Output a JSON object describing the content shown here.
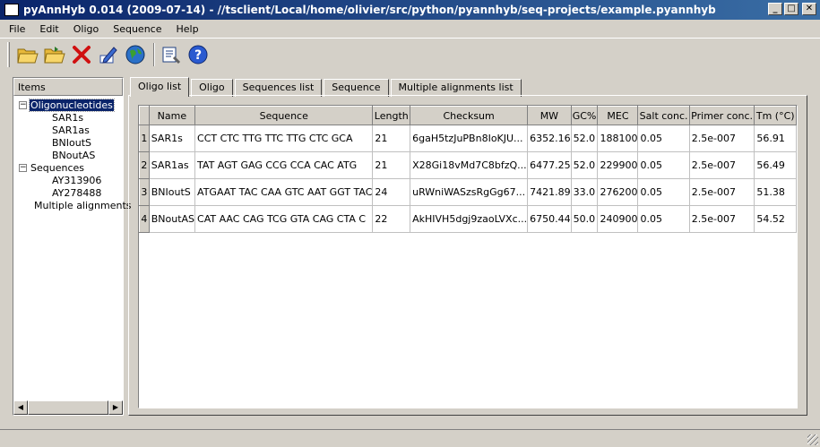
{
  "window": {
    "title": "pyAnnHyb 0.014 (2009-07-14) - //tsclient/Local/home/olivier/src/python/pyannhyb/seq-projects/example.pyannhyb",
    "minimize": "_",
    "maximize": "□",
    "close": "✕"
  },
  "menu": [
    "File",
    "Edit",
    "Oligo",
    "Sequence",
    "Help"
  ],
  "toolbar": {
    "open_icon": "open-folder-icon",
    "open2_icon": "open-folder-alt-icon",
    "delete_icon": "red-x-icon",
    "edit_icon": "pencil-icon",
    "globe_icon": "globe-icon",
    "tool_icon": "tool-icon",
    "help_icon": "help-icon"
  },
  "sidebar": {
    "header": "Items",
    "tree": {
      "oligos": {
        "label": "Oligonucleotides",
        "children": [
          "SAR1s",
          "SAR1as",
          "BNIoutS",
          "BNoutAS"
        ]
      },
      "sequences": {
        "label": "Sequences",
        "children": [
          "AY313906",
          "AY278488"
        ]
      },
      "alignments": {
        "label": "Multiple alignments"
      }
    },
    "expand_glyph": "−"
  },
  "tabs": [
    "Oligo list",
    "Oligo",
    "Sequences list",
    "Sequence",
    "Multiple alignments list"
  ],
  "table": {
    "columns": [
      "Name",
      "Sequence",
      "Length",
      "Checksum",
      "MW",
      "GC%",
      "MEC",
      "Salt conc.",
      "Primer conc.",
      "Tm (°C)"
    ],
    "rows": [
      {
        "n": "1",
        "cells": [
          "SAR1s",
          "CCT CTC TTG TTC TTG CTC GCA",
          "21",
          "6gaH5tzJuPBn8IoKJU...",
          "6352.16",
          "52.0",
          "188100",
          "0.05",
          "2.5e-007",
          "56.91"
        ]
      },
      {
        "n": "2",
        "cells": [
          "SAR1as",
          "TAT AGT GAG CCG CCA CAC ATG",
          "21",
          "X28Gi18vMd7C8bfzQ...",
          "6477.25",
          "52.0",
          "229900",
          "0.05",
          "2.5e-007",
          "56.49"
        ]
      },
      {
        "n": "3",
        "cells": [
          "BNIoutS",
          "ATGAAT TAC CAA GTC AAT GGT TAC",
          "24",
          "uRWniWASzsRgGg67...",
          "7421.89",
          "33.0",
          "276200",
          "0.05",
          "2.5e-007",
          "51.38"
        ]
      },
      {
        "n": "4",
        "cells": [
          "BNoutAS",
          "CAT AAC CAG TCG GTA CAG CTA C",
          "22",
          "AkHIVH5dgj9zaoLVXc...",
          "6750.44",
          "50.0",
          "240900",
          "0.05",
          "2.5e-007",
          "54.52"
        ]
      }
    ]
  }
}
